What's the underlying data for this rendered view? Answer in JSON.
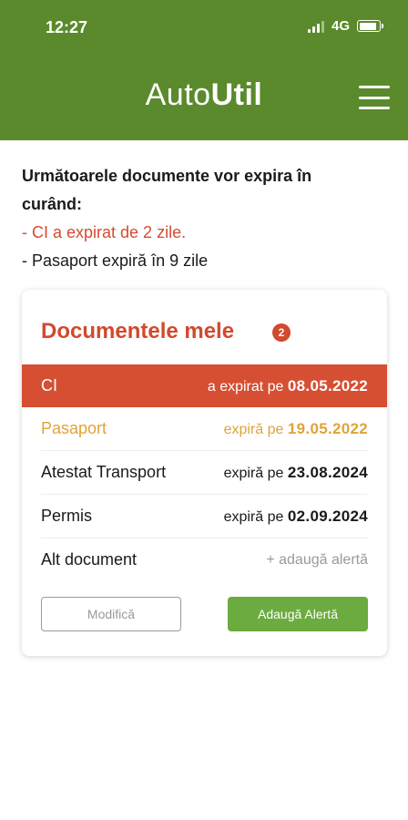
{
  "status_bar": {
    "time": "12:27",
    "network": "4G",
    "battery_level": 0.9
  },
  "app": {
    "title_light": "Auto",
    "title_bold": "Util"
  },
  "notice": {
    "heading_line1": "Următoarele documente vor expira în",
    "heading_line2": "curând:",
    "expired_line": "- CI a expirat de 2 zile.",
    "warning_line": "- Pasaport expiră în 9 zile"
  },
  "card": {
    "title": "Documentele mele",
    "badge_count": "2",
    "rows": [
      {
        "name": "CI",
        "prefix": "a expirat pe",
        "date": "08.05.2022",
        "status": "expired"
      },
      {
        "name": "Pasaport",
        "prefix": "expiră pe",
        "date": "19.05.2022",
        "status": "warning"
      },
      {
        "name": "Atestat Transport",
        "prefix": "expiră pe",
        "date": "23.08.2024",
        "status": "ok"
      },
      {
        "name": "Permis",
        "prefix": "expiră pe",
        "date": "02.09.2024",
        "status": "ok"
      }
    ],
    "add_row": {
      "name": "Alt document",
      "action": "+ adaugă alertă"
    },
    "modify_button": "Modifică",
    "add_button": "Adaugă Alertă"
  },
  "colors": {
    "header": "#5a8a2c",
    "accent_red": "#d2492e",
    "warning_orange": "#e0a33a",
    "button_green": "#6cab3f"
  },
  "icons": [
    "signal-icon",
    "battery-icon",
    "hamburger-menu-icon"
  ]
}
